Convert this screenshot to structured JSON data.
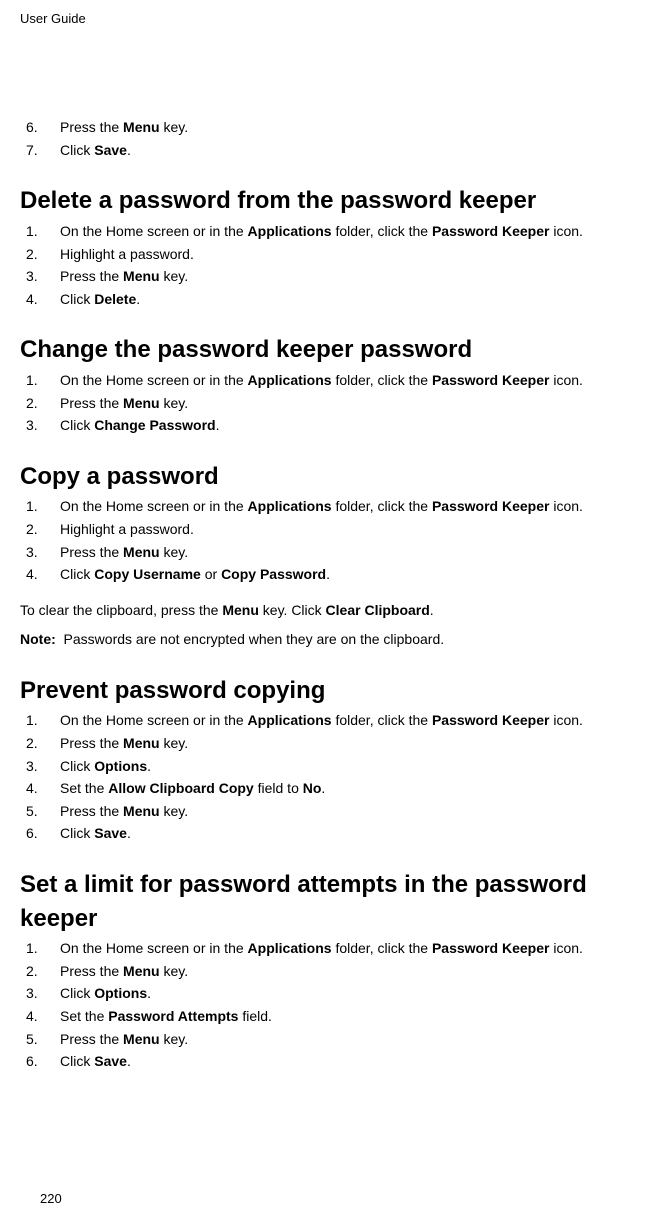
{
  "header": "User Guide",
  "footer": "220",
  "initial_steps": [
    {
      "num": "6.",
      "text": "Press the <b>Menu</b> key."
    },
    {
      "num": "7.",
      "text": "Click <b>Save</b>."
    }
  ],
  "sections": [
    {
      "title": "Delete a password from the password keeper",
      "steps": [
        {
          "num": "1.",
          "text": "On the Home screen or in the <b>Applications</b> folder, click the <b>Password Keeper</b> icon."
        },
        {
          "num": "2.",
          "text": "Highlight a password."
        },
        {
          "num": "3.",
          "text": "Press the <b>Menu</b> key."
        },
        {
          "num": "4.",
          "text": "Click <b>Delete</b>."
        }
      ]
    },
    {
      "title": "Change the password keeper password",
      "steps": [
        {
          "num": "1.",
          "text": "On the Home screen or in the <b>Applications</b> folder, click the <b>Password Keeper</b> icon."
        },
        {
          "num": "2.",
          "text": "Press the <b>Menu</b> key."
        },
        {
          "num": "3.",
          "text": "Click <b>Change Password</b>."
        }
      ]
    },
    {
      "title": "Copy a password",
      "steps": [
        {
          "num": "1.",
          "text": "On the Home screen or in the <b>Applications</b> folder, click the <b>Password Keeper</b> icon."
        },
        {
          "num": "2.",
          "text": "Highlight a password."
        },
        {
          "num": "3.",
          "text": "Press the <b>Menu</b> key."
        },
        {
          "num": "4.",
          "text": "Click <b>Copy Username</b> or <b>Copy Password</b>."
        }
      ],
      "after": [
        "To clear the clipboard, press the <b>Menu</b> key. Click <b>Clear Clipboard</b>.",
        "<b>Note:</b>&nbsp;&nbsp;Passwords are not encrypted when they are on the clipboard."
      ]
    },
    {
      "title": "Prevent password copying",
      "steps": [
        {
          "num": "1.",
          "text": "On the Home screen or in the <b>Applications</b> folder, click the <b>Password Keeper</b> icon."
        },
        {
          "num": "2.",
          "text": "Press the <b>Menu</b> key."
        },
        {
          "num": "3.",
          "text": "Click <b>Options</b>."
        },
        {
          "num": "4.",
          "text": "Set the <b>Allow Clipboard Copy</b> field to <b>No</b>."
        },
        {
          "num": "5.",
          "text": "Press the <b>Menu</b> key."
        },
        {
          "num": "6.",
          "text": "Click <b>Save</b>."
        }
      ]
    },
    {
      "title": "Set a limit for password attempts in the password keeper",
      "steps": [
        {
          "num": "1.",
          "text": "On the Home screen or in the <b>Applications</b> folder, click the <b>Password Keeper</b> icon."
        },
        {
          "num": "2.",
          "text": "Press the <b>Menu</b> key."
        },
        {
          "num": "3.",
          "text": "Click <b>Options</b>."
        },
        {
          "num": "4.",
          "text": "Set the <b>Password Attempts</b> field."
        },
        {
          "num": "5.",
          "text": "Press the <b>Menu</b> key."
        },
        {
          "num": "6.",
          "text": "Click <b>Save</b>."
        }
      ]
    }
  ]
}
